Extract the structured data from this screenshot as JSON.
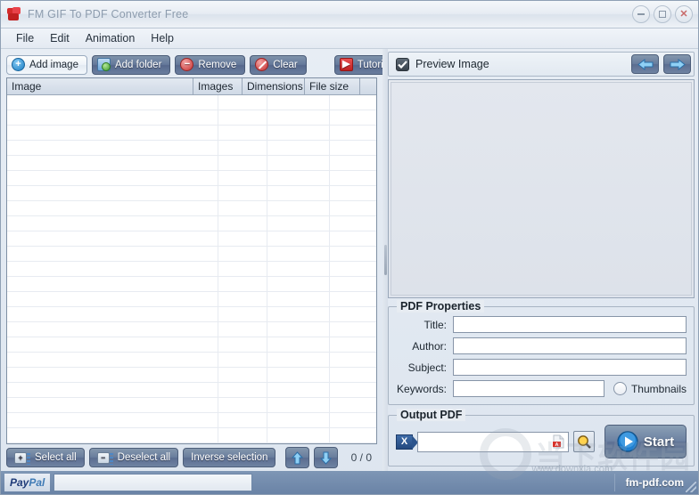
{
  "window": {
    "title": "FM GIF To PDF Converter Free",
    "icon": "app-icon",
    "controls": {
      "minimize": "─",
      "maximize": "□",
      "close": "✕"
    }
  },
  "menu": {
    "items": [
      {
        "label": "File"
      },
      {
        "label": "Edit"
      },
      {
        "label": "Animation"
      },
      {
        "label": "Help"
      }
    ]
  },
  "toolbar": {
    "buttons": [
      {
        "label": "Add image",
        "icon": "add-circle-icon",
        "style": "light"
      },
      {
        "label": "Add folder",
        "icon": "folder-add-icon",
        "style": "dark"
      },
      {
        "label": "Remove",
        "icon": "minus-circle-icon",
        "style": "dark"
      },
      {
        "label": "Clear",
        "icon": "no-entry-icon",
        "style": "dark"
      },
      {
        "label": "Tutorial",
        "icon": "play-icon",
        "style": "dark"
      }
    ]
  },
  "image_list": {
    "columns": [
      {
        "label": "Image"
      },
      {
        "label": "Images"
      },
      {
        "label": "Dimensions"
      },
      {
        "label": "File size"
      }
    ],
    "rows": []
  },
  "bottom_toolbar": {
    "select_all": "Select all",
    "deselect_all": "Deselect all",
    "inverse_selection": "Inverse selection",
    "move_up_icon": "arrow-up-icon",
    "move_down_icon": "arrow-down-icon",
    "count": "0 / 0"
  },
  "preview": {
    "checkbox_label": "Preview Image",
    "checked": true,
    "prev_icon": "arrow-left-icon",
    "next_icon": "arrow-right-icon"
  },
  "pdf_properties": {
    "title_group": "PDF Properties",
    "fields": [
      {
        "label": "Title:",
        "value": "",
        "placeholder": ""
      },
      {
        "label": "Author:",
        "value": "",
        "placeholder": ""
      },
      {
        "label": "Subject:",
        "value": "",
        "placeholder": ""
      },
      {
        "label": "Keywords:",
        "value": "",
        "placeholder": ""
      }
    ],
    "thumbnails_label": "Thumbnails",
    "thumbnails_checked": false
  },
  "output_pdf": {
    "title_group": "Output PDF",
    "path_value": "",
    "path_placeholder": "",
    "x_badge": "X",
    "pdf_icon": "pdf-file-icon",
    "browse_icon": "magnifier-icon",
    "start_label": "Start",
    "start_icon": "play-circle-icon"
  },
  "status_bar": {
    "paypal_label_1": "Pay",
    "paypal_label_2": "Pal",
    "progress_value": 0,
    "site": "fm-pdf.com"
  },
  "watermark": {
    "text": "当下软件园",
    "sub": "www.downxia.com"
  },
  "colors": {
    "titlebar_text": "#8d9cae",
    "button_dark": "#64789a",
    "button_border": "#4a5b77",
    "accent_blue": "#2e7fc6",
    "status_bar": "#6a83a6"
  }
}
